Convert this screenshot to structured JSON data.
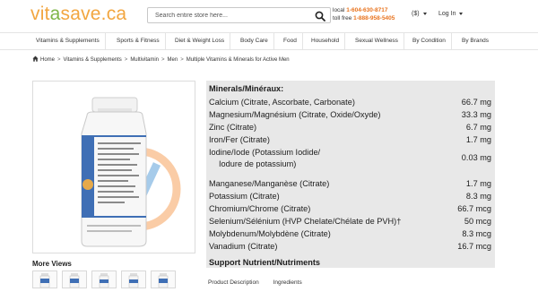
{
  "header": {
    "logo_part1": "vit",
    "logo_dot": "a",
    "logo_part2": "save.ca",
    "search_placeholder": "Search entire store here...",
    "local_label": "local",
    "local_number": "1-604-630-8717",
    "tollfree_label": "toll free",
    "tollfree_number": "1-888-958-5405",
    "currency": "($)",
    "login": "Log In"
  },
  "nav": [
    "Vitamins & Supplements",
    "Sports & Fitness",
    "Diet & Weight Loss",
    "Body Care",
    "Food",
    "Household",
    "Sexual Wellness",
    "By Condition",
    "By Brands"
  ],
  "breadcrumb": [
    "Home",
    "Vitamins & Supplements",
    "Multivitamin",
    "Men",
    "Multiple Vitamins & Minerals for Active Men"
  ],
  "product": {
    "more_views": "More Views",
    "tabs": [
      "Product Description",
      "Ingredients"
    ]
  },
  "label_lines": [
    {
      "text": "Minerals/Minéraux:",
      "value": "",
      "head": true
    },
    {
      "text": "Calcium (Citrate, Ascorbate, Carbonate)",
      "value": "66.7 mg"
    },
    {
      "text": "Magnesium/Magnésium (Citrate, Oxide/Oxyde)",
      "value": "33.3 mg"
    },
    {
      "text": "Zinc (Citrate)",
      "value": "6.7 mg"
    },
    {
      "text": "Iron/Fer (Citrate)",
      "value": "1.7 mg"
    },
    {
      "text": "Iodine/Iode (Potassium Iodide/",
      "value": "0.03 mg"
    },
    {
      "text": "  Iodure de potassium)",
      "value": ""
    },
    {
      "text": "Manganese/Manganèse (Citrate)",
      "value": "1.7 mg"
    },
    {
      "text": "Potassium (Citrate)",
      "value": "8.3 mg"
    },
    {
      "text": "Chromium/Chrome (Citrate)",
      "value": "66.7 mcg"
    },
    {
      "text": "Selenium/Sélénium (HVP Chelate/Chélate de PVH)†",
      "value": "50 mcg"
    },
    {
      "text": "Molybdenum/Molybdène (Citrate)",
      "value": "8.3 mcg"
    },
    {
      "text": "Vanadium (Citrate)",
      "value": "16.7 mcg"
    },
    {
      "text": "Support Nutrient/Nutriments",
      "value": "",
      "head": true
    }
  ],
  "colors": {
    "logo_orange": "#f2a640",
    "logo_green": "#7fb547",
    "phone_orange": "#e8731e",
    "watermark_orange": "#f5a25d",
    "watermark_blue": "#5da0d8"
  }
}
